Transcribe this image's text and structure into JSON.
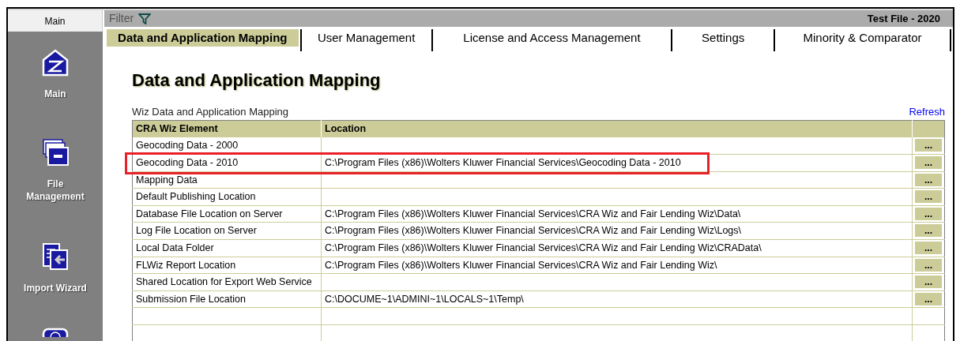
{
  "sidebar": {
    "header": "Main",
    "items": [
      {
        "kind": "home",
        "label": "Main"
      },
      {
        "kind": "files",
        "label": "File Management"
      },
      {
        "kind": "import",
        "label": "Import Wizard"
      },
      {
        "kind": "partial"
      }
    ]
  },
  "top_bar": {
    "filter_label": "Filter",
    "file_name": "Test File - 2020"
  },
  "tabs": [
    {
      "label": "Data and Application Mapping",
      "selected": true
    },
    {
      "label": "User Management",
      "selected": false
    },
    {
      "label": "License and Access Management",
      "selected": false
    },
    {
      "label": "Settings",
      "selected": false
    },
    {
      "label": "Minority & Comparator",
      "selected": false
    }
  ],
  "page_title": "Data and Application Mapping",
  "table": {
    "caption": "Wiz Data and Application Mapping",
    "refresh_link": "Refresh",
    "columns": [
      "CRA Wiz Element",
      "Location"
    ],
    "rows": [
      {
        "element": "Geocoding Data - 2000",
        "location": "",
        "button": "...",
        "highlighted": false
      },
      {
        "element": "Geocoding Data - 2010",
        "location": "C:\\Program Files (x86)\\Wolters Kluwer Financial Services\\Geocoding Data - 2010",
        "button": "...",
        "highlighted": true
      },
      {
        "element": "Mapping Data",
        "location": "",
        "button": "...",
        "highlighted": false
      },
      {
        "element": "Default Publishing Location",
        "location": "",
        "button": "...",
        "highlighted": false
      },
      {
        "element": "Database File Location on Server",
        "location": "C:\\Program Files (x86)\\Wolters Kluwer Financial Services\\CRA Wiz and Fair Lending Wiz\\Data\\",
        "button": "...",
        "highlighted": false
      },
      {
        "element": "Log File Location on Server",
        "location": "C:\\Program Files (x86)\\Wolters Kluwer Financial Services\\CRA Wiz and Fair Lending Wiz\\Logs\\",
        "button": "...",
        "highlighted": false
      },
      {
        "element": "Local Data Folder",
        "location": "C:\\Program Files (x86)\\Wolters Kluwer Financial Services\\CRA Wiz and Fair Lending Wiz\\CRAData\\",
        "button": "...",
        "highlighted": false
      },
      {
        "element": "FLWiz Report Location",
        "location": "C:\\Program Files (x86)\\Wolters Kluwer Financial Services\\CRA Wiz and Fair Lending Wiz\\",
        "button": "...",
        "highlighted": false
      },
      {
        "element": "Shared Location for Export Web Service",
        "location": "",
        "button": "...",
        "highlighted": false
      },
      {
        "element": "Submission File Location",
        "location": "C:\\DOCUME~1\\ADMINI~1\\LOCALS~1\\Temp\\",
        "button": "...",
        "highlighted": false
      }
    ]
  }
}
